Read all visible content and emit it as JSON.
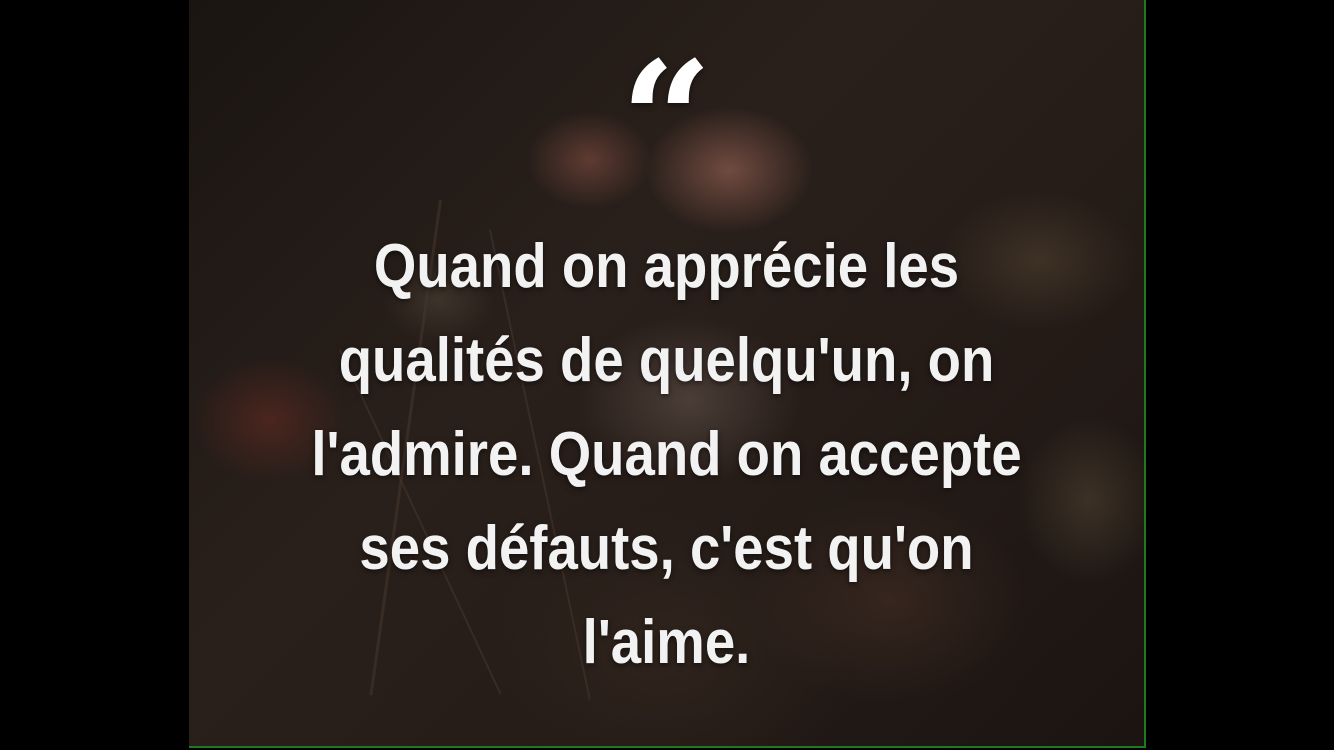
{
  "quote": {
    "mark": "“",
    "lines": [
      "Quand on apprécie les",
      "qualités de quelqu'un, on",
      "l'admire. Quand on accepte",
      "ses défauts, c'est qu'on",
      "l'aime."
    ]
  },
  "colors": {
    "text": "#f2f2f2",
    "background": "#000000",
    "frame_edge": "#1f7a1f"
  }
}
